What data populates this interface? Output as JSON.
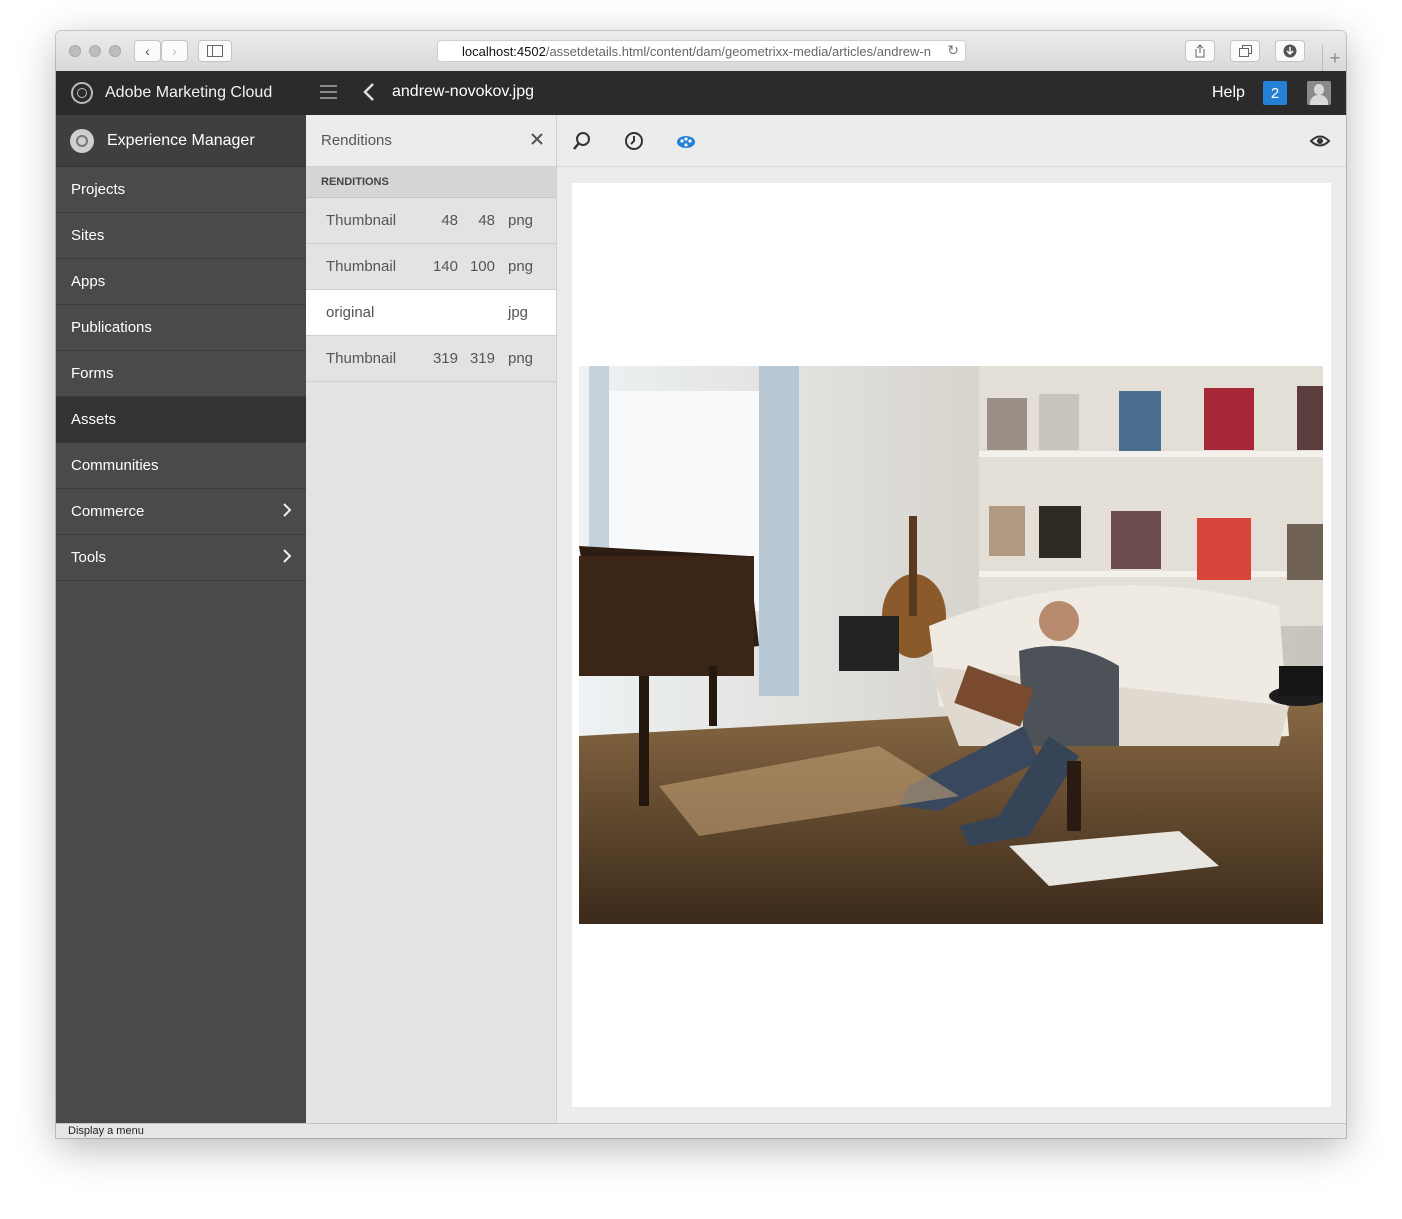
{
  "browser": {
    "url_host": "localhost:4502",
    "url_path": "/assetdetails.html/content/dam/geometrixx-media/articles/andrew-n",
    "status_text": "Display a menu"
  },
  "header": {
    "brand": "Adobe Marketing Cloud",
    "asset_title": "andrew-novokov.jpg",
    "help_label": "Help",
    "notification_count": "2"
  },
  "sidebar": {
    "title": "Experience Manager",
    "items": [
      {
        "label": "Projects"
      },
      {
        "label": "Sites"
      },
      {
        "label": "Apps"
      },
      {
        "label": "Publications"
      },
      {
        "label": "Forms"
      },
      {
        "label": "Assets",
        "active": true
      },
      {
        "label": "Communities"
      },
      {
        "label": "Commerce",
        "has_children": true
      },
      {
        "label": "Tools",
        "has_children": true
      }
    ]
  },
  "renditions_panel": {
    "title": "Renditions",
    "section_label": "RENDITIONS",
    "rows": [
      {
        "name": "Thumbnail",
        "width": "48",
        "height": "48",
        "format": "png"
      },
      {
        "name": "Thumbnail",
        "width": "140",
        "height": "100",
        "format": "png"
      },
      {
        "name": "original",
        "width": "",
        "height": "",
        "format": "jpg",
        "selected": true
      },
      {
        "name": "Thumbnail",
        "width": "319",
        "height": "319",
        "format": "png"
      }
    ]
  },
  "toolbar": {
    "icons": [
      "search-icon",
      "timeline-icon",
      "palette-icon",
      "eye-icon"
    ],
    "active_icon_color": "#2480d4"
  },
  "colors": {
    "header_bg": "#2b2b2b",
    "sidebar_bg": "#4a4a4a",
    "accent": "#2480d4"
  }
}
